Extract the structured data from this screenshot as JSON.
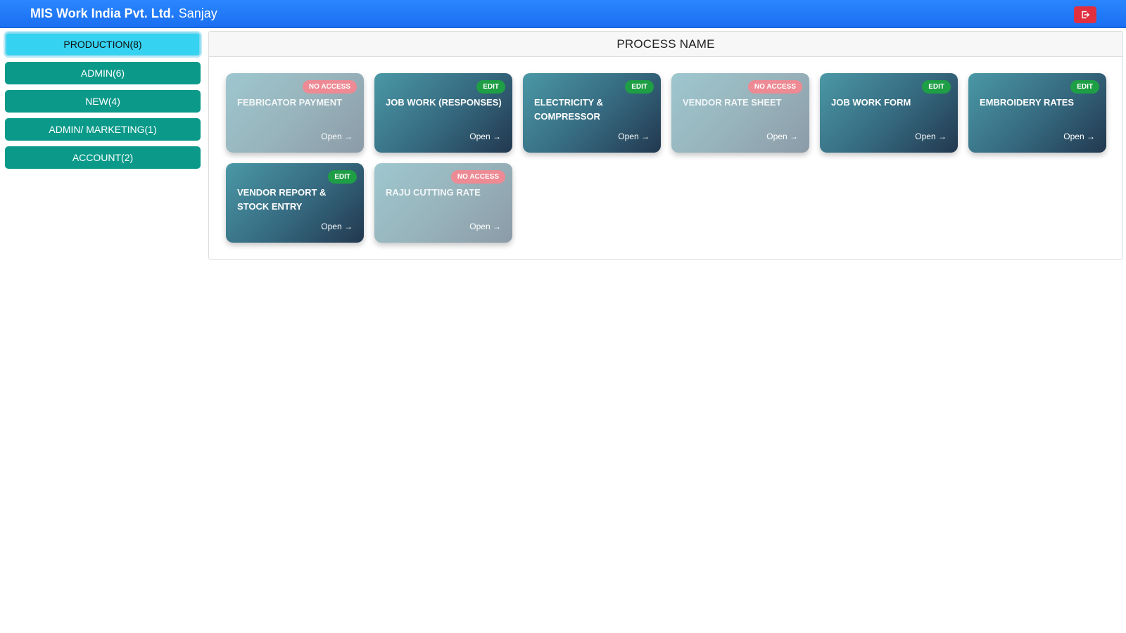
{
  "header": {
    "company": "MIS Work India Pvt. Ltd.",
    "user": "Sanjay",
    "logout_icon": "logout-icon",
    "logout_color": "#e03040"
  },
  "sidebar": {
    "items": [
      {
        "label": "PRODUCTION(8)",
        "active": true
      },
      {
        "label": "ADMIN(6)",
        "active": false
      },
      {
        "label": "NEW(4)",
        "active": false
      },
      {
        "label": "ADMIN/ MARKETING(1)",
        "active": false
      },
      {
        "label": "ACCOUNT(2)",
        "active": false
      }
    ]
  },
  "main": {
    "title": "PROCESS NAME",
    "cards": [
      {
        "title": "FEBRICATOR PAYMENT",
        "badge": "NO ACCESS",
        "access": "noaccess",
        "open": "Open →"
      },
      {
        "title": "JOB WORK (RESPONSES)",
        "badge": "EDIT",
        "access": "edit",
        "open": "Open →"
      },
      {
        "title": "ELECTRICITY & COMPRESSOR",
        "badge": "EDIT",
        "access": "edit",
        "open": "Open →"
      },
      {
        "title": "VENDOR RATE SHEET",
        "badge": "NO ACCESS",
        "access": "noaccess",
        "open": "Open →"
      },
      {
        "title": "JOB WORK FORM",
        "badge": "EDIT",
        "access": "edit",
        "open": "Open →"
      },
      {
        "title": "EMBROIDERY RATES",
        "badge": "EDIT",
        "access": "edit",
        "open": "Open →"
      },
      {
        "title": "VENDOR REPORT & STOCK ENTRY",
        "badge": "EDIT",
        "access": "edit",
        "open": "Open →"
      },
      {
        "title": "RAJU CUTTING RATE",
        "badge": "NO ACCESS",
        "access": "noaccess",
        "open": "Open →"
      }
    ]
  },
  "colors": {
    "topbar": "#1a6ff0",
    "sidebar_button": "#0b9a8a",
    "sidebar_active": "#35d2f2",
    "edit_badge": "#1e9e45",
    "noaccess_badge": "#ee8a94"
  }
}
